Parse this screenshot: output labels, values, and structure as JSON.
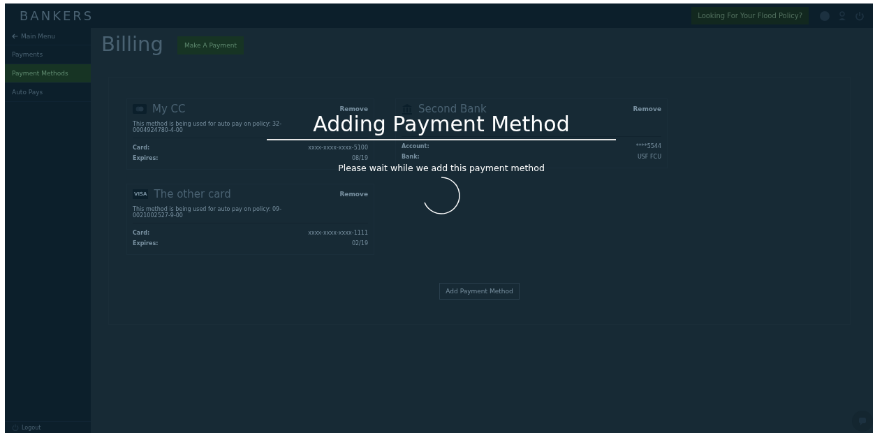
{
  "header": {
    "logo": "BANKERS",
    "flood_button": "Looking For Your Flood Policy?"
  },
  "sidebar": {
    "back_link": "Main Menu",
    "items": [
      {
        "label": "Payments",
        "selected": false
      },
      {
        "label": "Payment Methods",
        "selected": true
      },
      {
        "label": "Auto Pays",
        "selected": false
      }
    ],
    "logout": "Logout"
  },
  "page": {
    "title": "Billing",
    "make_payment_button": "Make A Payment",
    "methods": [
      {
        "kind": "mastercard",
        "name": "My CC",
        "remove": "Remove",
        "description": "This method is being used for auto pay on policy: 32-0004924780-4-00",
        "fields": [
          {
            "label": "Card:",
            "value": "xxxx-xxxx-xxxx-5100"
          },
          {
            "label": "Expires:",
            "value": "08/19"
          }
        ]
      },
      {
        "kind": "bank",
        "name": "Second Bank",
        "remove": "Remove",
        "fields": [
          {
            "label": "Account:",
            "value": "****5544"
          },
          {
            "label": "Bank:",
            "value": "USF FCU"
          }
        ]
      },
      {
        "kind": "visa",
        "badge": "VISA",
        "name": "The other card",
        "remove": "Remove",
        "description": "This method is being used for auto pay on policy: 09-0021002527-9-00",
        "fields": [
          {
            "label": "Card:",
            "value": "xxxx-xxxx-xxxx-1111"
          },
          {
            "label": "Expires:",
            "value": "02/19"
          }
        ]
      }
    ],
    "add_button": "Add Payment Method"
  },
  "modal": {
    "title": "Adding Payment Method",
    "message": "Please wait while we add this payment method"
  }
}
